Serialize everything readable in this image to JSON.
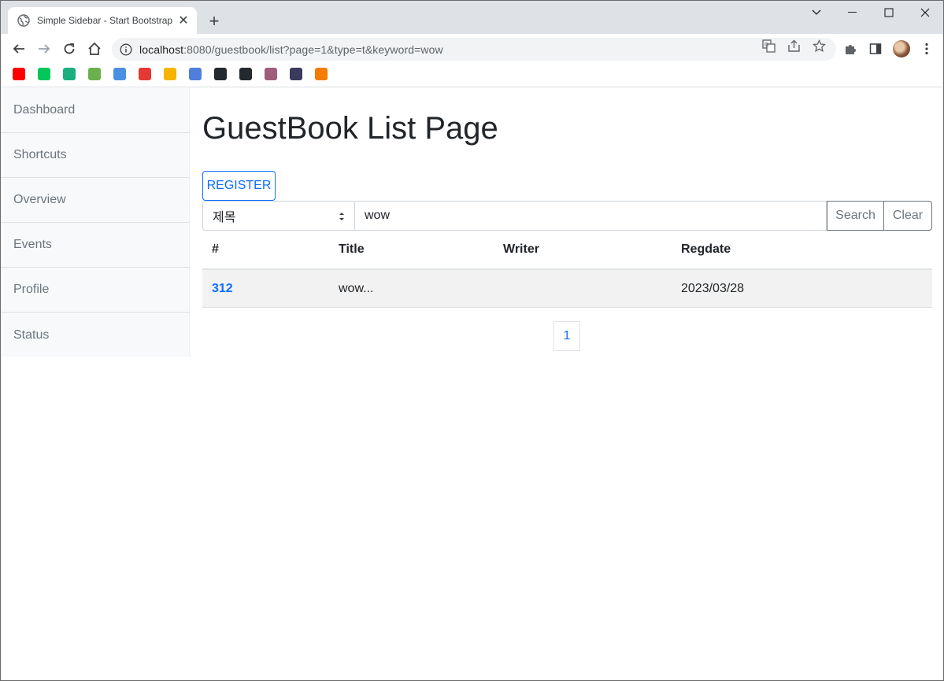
{
  "browser": {
    "tab_title": "Simple Sidebar - Start Bootstrap",
    "new_tab_label": "+",
    "url_host": "localhost",
    "url_rest": ":8080/guestbook/list?page=1&type=t&keyword=wow"
  },
  "bookmarks": [
    {
      "name": "youtube",
      "color": "#ff0000"
    },
    {
      "name": "naver",
      "color": "#03c75a"
    },
    {
      "name": "bookmark-3",
      "color": "#1aaf7f"
    },
    {
      "name": "bookmark-4",
      "color": "#6ab04c"
    },
    {
      "name": "bookmark-5",
      "color": "#4a90e2"
    },
    {
      "name": "bookmark-6",
      "color": "#e53935"
    },
    {
      "name": "bookmark-7",
      "color": "#f5b400"
    },
    {
      "name": "bookmark-8",
      "color": "#4f7fdb"
    },
    {
      "name": "bookmark-9",
      "color": "#24292f"
    },
    {
      "name": "github",
      "color": "#24292f"
    },
    {
      "name": "bookmark-11",
      "color": "#a05c7b"
    },
    {
      "name": "bookmark-12",
      "color": "#3a3a5c"
    },
    {
      "name": "bookmark-13",
      "color": "#f57c00"
    }
  ],
  "sidebar": {
    "items": [
      "Dashboard",
      "Shortcuts",
      "Overview",
      "Events",
      "Profile",
      "Status"
    ]
  },
  "main": {
    "title": "GuestBook List Page",
    "register_label": "REGISTER",
    "search": {
      "type_selected": "제목",
      "keyword": "wow",
      "search_label": "Search",
      "clear_label": "Clear"
    },
    "table": {
      "headers": [
        "#",
        "Title",
        "Writer",
        "Regdate"
      ],
      "rows": [
        {
          "gno": "312",
          "title": "wow...",
          "writer": "",
          "regdate": "2023/03/28"
        }
      ]
    },
    "pagination": {
      "pages": [
        "1"
      ]
    }
  }
}
